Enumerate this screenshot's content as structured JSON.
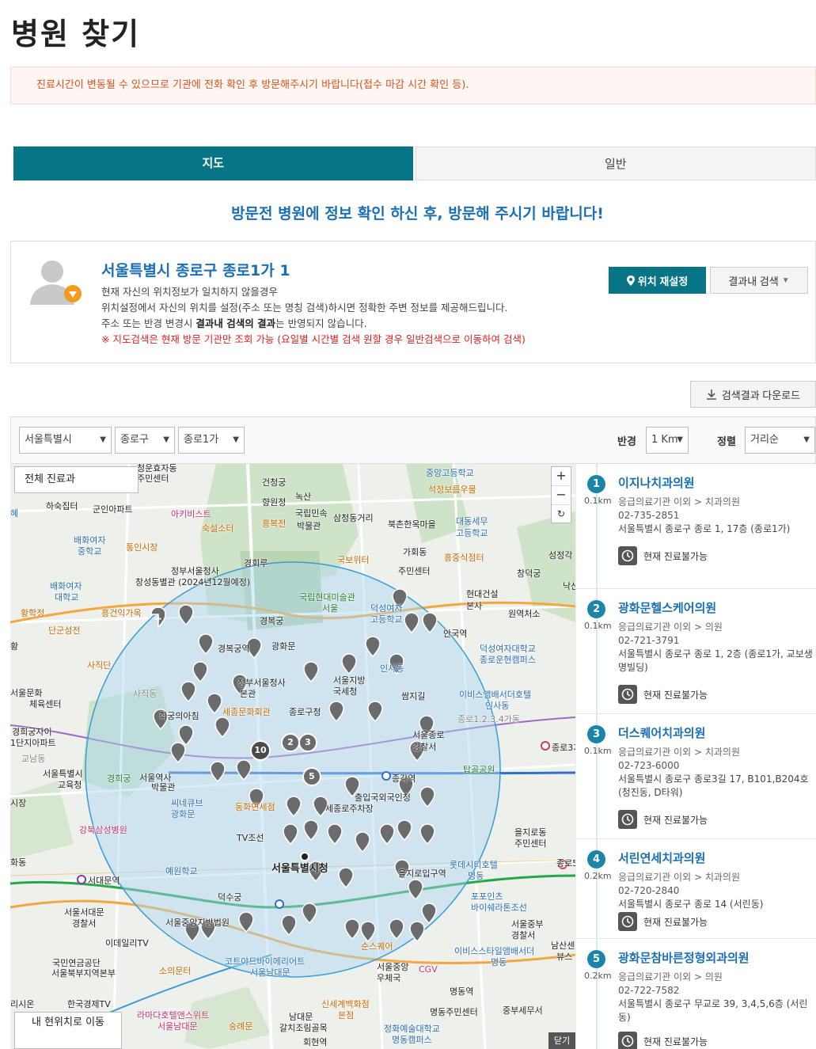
{
  "page_title": "병원 찾기",
  "notice": "진료시간이 변동될 수 있으므로 기관에 전화 확인 후 방문해주시기 바랍니다(접수 마감 시간 확인 등).",
  "tabs": [
    {
      "label": "지도",
      "active": true
    },
    {
      "label": "일반",
      "active": false
    }
  ],
  "headline": "방문전 병원에 정보 확인 하신 후, 방문해 주시기 바랍니다!",
  "location": {
    "address": "서울특별시 종로구 종로1가 1",
    "desc_line1": "현재 자신의 위치정보가 일치하지 않을경우",
    "desc_line2": "위치설정에서 자신의 위치를 설정(주소 또는 명칭 검색)하시면 정확한 주변 정보를 제공해드립니다.",
    "desc_line3_a": "주소 또는 반경 변경시 ",
    "desc_line3_b": "결과내 검색의 결과",
    "desc_line3_c": "는 반영되지 않습니다.",
    "warning": "※ 지도검색은 현재 방문 기관만 조회 가능 (요일별 시간별 검색 원할 경우 일반검색으로 이동하여 검색)",
    "reset_label": "위치 재설정",
    "search_in_label": "결과내 검색"
  },
  "download_label": "검색결과 다운로드",
  "filters": {
    "sido": "서울특별시",
    "sigungu": "종로구",
    "dong": "종로1가",
    "radius_label": "반경",
    "radius_value": "1 Km",
    "sort_label": "정렬",
    "sort_value": "거리순"
  },
  "map": {
    "dept_button": "전체 진료과",
    "zoom_in": "+",
    "zoom_out": "−",
    "zoom_reset": "↻",
    "my_location": "내 현위치로 이동",
    "corner_label": "닫기",
    "labels": {
      "l1": "청운효자동",
      "l2": "주민센터",
      "l3": "건청궁",
      "l4": "녹산",
      "l5": "중앙고등학교",
      "l6": "석정보름우물",
      "l7": "하숙집터",
      "l8": "군인아파트",
      "l9": "아키비스트",
      "l10": "향원정",
      "l11": "국립민속",
      "l12": "박물관",
      "l13": "삼청동거리",
      "l14": "북촌한옥마을",
      "l15": "대동세무",
      "l16": "고등학교",
      "l17": "숙설소터",
      "l18": "흥복전",
      "l19": "배화여자",
      "l20": "중학교",
      "l21": "통인시장",
      "l22": "경회루",
      "l23": "국보위터",
      "l24": "가회동",
      "l25": "주민센터",
      "l26": "흥중식점터",
      "l27": "정부서울청사",
      "l28": "창성동별관 (2024년12월예정)",
      "l29": "국립현대미술관",
      "l30": "서울",
      "l31": "현대건설",
      "l32": "본사",
      "l33": "배화여자",
      "l34": "대학교",
      "l35": "황학정",
      "l36": "흥건익가옥",
      "l37": "경복궁",
      "l38": "덕성여자",
      "l39": "고등학교",
      "l40": "원역처소",
      "l41": "단군성전",
      "l42": "경복궁역",
      "l43": "광화문",
      "l44": "안국역",
      "l45": "사직단",
      "l46": "인사동",
      "l47": "덕성여자대학교",
      "l48": "종로운현캠퍼스",
      "l49": "서울지방",
      "l50": "국세청",
      "l51": "쌈지길",
      "l52": "서울문화",
      "l53": "체육센터",
      "l54": "사직동",
      "l55": "정부서울청사",
      "l56": "본관",
      "l57": "종로구청",
      "l58": "이비스앰배서더호텔",
      "l59": "인사동",
      "l60": "희궁의아침",
      "l61": "세종문화회관",
      "l62": "경희궁자이",
      "l63": "1단지아파트",
      "l64": "서울종로",
      "l65": "경찰서",
      "l66": "종로3가역",
      "l67": "교남동",
      "l68": "탑골공원",
      "l69": "서울특별시",
      "l70": "교육청",
      "l71": "경희궁",
      "l72": "서울역사",
      "l73": "박물관",
      "l74": "종각역",
      "l75": "종로1.2.3.4가동",
      "l76": "출입국외국인청",
      "l77": "세종로주차장",
      "l78": "씨네큐브",
      "l79": "광화문",
      "l80": "동화면세점",
      "l81": "을지로동",
      "l82": "주민센터",
      "l83": "강북삼성병원",
      "l84": "TV조선",
      "l85": "서울특별시청",
      "l86": "롯데시티호텔",
      "l87": "명동",
      "l88": "예원학교",
      "l89": "서대문역",
      "l90": "을지로입구역",
      "l91": "포포인츠",
      "l92": "바이쉐라톤조선",
      "l93": "서울서대문",
      "l94": "경찰서",
      "l95": "서울중부",
      "l96": "경찰서",
      "l97": "이데일리TV",
      "l98": "덕수궁",
      "l99": "서울중앙지방법원",
      "l100": "순스퀘어",
      "l101": "이비스스타일앰배서더",
      "l102": "명동",
      "l103": "국민연금공단",
      "l104": "서울북부지역본부",
      "l105": "소의문터",
      "l106": "코트야드바이메리어트",
      "l107": "서울남대문",
      "l108": "서울중앙",
      "l109": "우체국",
      "l110": "CGV",
      "l111": "남산센",
      "l112": "뷰스",
      "l113": "한국경제TV",
      "l114": "명동역",
      "l115": "리시온",
      "l116": "라마다호텔앤스위트",
      "l117": "서울남대문",
      "l118": "신세계백화점",
      "l119": "본점",
      "l120": "명동주민센터",
      "l121": "중부세무서",
      "l122": "숭례문",
      "l123": "남대문",
      "l124": "갈치조림골목",
      "l125": "정화예술대학교",
      "l126": "명동캠퍼스",
      "l127": "회현역",
      "l128": "창덕궁",
      "l129": "성정각",
      "l130": "낙산",
      "l131": "혜",
      "l132": "황",
      "l133": "화동",
      "l134": "시장",
      "l135": "종로5"
    },
    "cluster_numbers": [
      "10",
      "2",
      "3",
      "5"
    ]
  },
  "results": [
    {
      "no": "1",
      "dist": "0.1km",
      "name": "이지나치과의원",
      "category": "응급의료기관 이외 > 치과의원",
      "tel": "02-735-2851",
      "address": "서울특별시 종로구 종로 1, 17층 (종로1가)",
      "status": "현재 진료불가능"
    },
    {
      "no": "2",
      "dist": "0.1km",
      "name": "광화문헬스케어의원",
      "category": "응급의료기관 이외 > 의원",
      "tel": "02-721-3791",
      "address": "서울특별시 종로구 종로 1, 2층 (종로1가, 교보생명빌딩)",
      "status": "현재 진료불가능"
    },
    {
      "no": "3",
      "dist": "0.1km",
      "name": "더스퀘어치과의원",
      "category": "응급의료기관 이외 > 치과의원",
      "tel": "02-723-6000",
      "address": "서울특별시 종로구 종로3길 17, B101,B204호 (청진동, D타워)",
      "status": "현재 진료불가능"
    },
    {
      "no": "4",
      "dist": "0.2km",
      "name": "서린연세치과의원",
      "category": "응급의료기관 이외 > 치과의원",
      "tel": "02-720-2840",
      "address": "서울특별시 종로구 종로 14 (서린동)",
      "status": "현재 진료불가능"
    },
    {
      "no": "5",
      "dist": "0.2km",
      "name": "광화문참바른정형외과의원",
      "category": "응급의료기관 이외 > 의원",
      "tel": "02-722-7582",
      "address": "서울특별시 종로구 무교로 39, 3,4,5,6층 (서린동)",
      "status": "현재 진료불가능"
    }
  ]
}
